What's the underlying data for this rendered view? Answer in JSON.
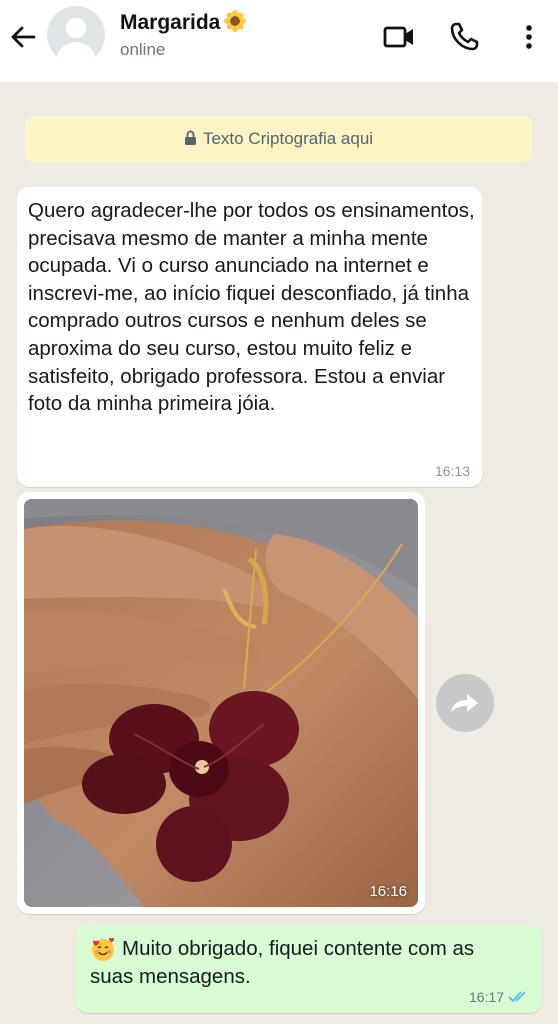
{
  "header": {
    "contact_name": "Margarida",
    "status": "online",
    "icons": [
      "back-arrow-icon",
      "avatar",
      "sunflower-emoji",
      "video-call-icon",
      "phone-call-icon",
      "more-vert-icon"
    ]
  },
  "chat": {
    "encryption_notice": "Texto Criptografia aqui",
    "messages": [
      {
        "direction": "incoming",
        "type": "text",
        "text": "Quero agradecer-lhe por todos os ensinamentos, precisava mesmo de manter a minha mente ocupada. Vi o curso anunciado na internet e inscrevi-me, ao início fiquei desconfiado, já tinha comprado outros cursos e nenhum deles se aproxima do seu curso, estou muito feliz e satisfeito, obrigado professora. Estou a enviar foto da minha primeira jóia.",
        "time": "16:13"
      },
      {
        "direction": "incoming",
        "type": "image",
        "image_description": "hand holding a pressed dark red orchid pendant on a gold chain",
        "time": "16:16"
      },
      {
        "direction": "outgoing",
        "type": "text",
        "emoji": "smiling-face-with-hearts",
        "text": "Muito obrigado, fiquei contente com as suas mensagens.",
        "time": "16:17",
        "read_status": "read"
      }
    ]
  },
  "colors": {
    "header_bg": "#ffffff",
    "chat_bg": "#efeae2",
    "encryption_bg": "#fdf4c5",
    "incoming_bubble": "#ffffff",
    "outgoing_bubble": "#d9fdd3",
    "read_ticks": "#53bdeb"
  }
}
